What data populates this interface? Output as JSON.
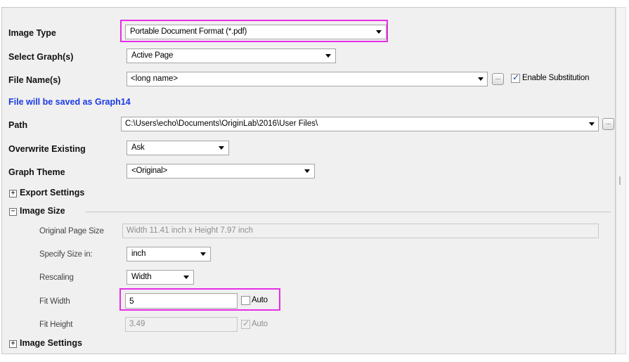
{
  "dialog": {
    "image_type": {
      "label": "Image Type",
      "value": "Portable Document Format (*.pdf)"
    },
    "select_graphs": {
      "label": "Select Graph(s)",
      "value": "Active Page"
    },
    "file_names": {
      "label": "File Name(s)",
      "value": "<long name>",
      "enable_substitution": {
        "label": "Enable Substitution",
        "checked": true
      }
    },
    "save_info": "File will be saved as Graph14",
    "path": {
      "label": "Path",
      "value": "C:\\Users\\echo\\Documents\\OriginLab\\2016\\User Files\\"
    },
    "overwrite_existing": {
      "label": "Overwrite Existing",
      "value": "Ask"
    },
    "graph_theme": {
      "label": "Graph Theme",
      "value": "<Original>"
    },
    "export_settings": {
      "label": "Export Settings",
      "toggle": "+"
    },
    "image_size": {
      "label": "Image Size",
      "toggle": "−",
      "original_page_size": {
        "label": "Original Page Size",
        "value": "Width 11.41 inch x Height 7.97 inch"
      },
      "specify_size_in": {
        "label": "Specify Size in:",
        "value": "inch"
      },
      "rescaling": {
        "label": "Rescaling",
        "value": "Width"
      },
      "fit_width": {
        "label": "Fit Width",
        "value": "5",
        "auto": {
          "label": "Auto",
          "checked": false
        }
      },
      "fit_height": {
        "label": "Fit Height",
        "value": "3.49",
        "auto": {
          "label": "Auto",
          "checked": true
        }
      }
    },
    "image_settings": {
      "label": "Image Settings",
      "toggle": "+"
    },
    "ellipsis": "..."
  },
  "colors": {
    "highlight": "#e62ee6",
    "info_text": "#1a39e6"
  }
}
